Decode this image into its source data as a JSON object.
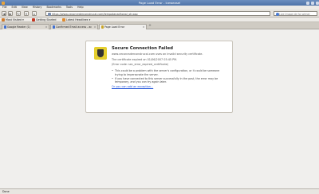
{
  "window": {
    "title": "Page Load Error - Iceweasel"
  },
  "menu": [
    "File",
    "Edit",
    "View",
    "History",
    "Bookmarks",
    "Tools",
    "Help"
  ],
  "nav": {
    "url": "https://www.ceconrederconstrucal.com/tempotanadhonal_otr.asp",
    "search_placeholder": "Live Image de for wimer"
  },
  "bookmarks": [
    {
      "label": "Most Visited ▾",
      "color": "#d07a2a"
    },
    {
      "label": "Getting Started",
      "color": "#c4341e"
    },
    {
      "label": "Latest Headlines ▾",
      "color": "#e08a2e"
    }
  ],
  "tabs": [
    {
      "label": "Google Reader (1)",
      "color": "#3f6fd1"
    },
    {
      "label": "Confirmed Email access - ac",
      "color": "#3f6fd1"
    },
    {
      "label": "Page Load Error",
      "color": "#c9a52a"
    }
  ],
  "error": {
    "title": "Secure Connection Failed",
    "line1": "www.ceconraderconstrucal.com uses an invalid security certificate.",
    "line2": "The certificate expired on 01/06/2007 03:45 PM.",
    "code": "(Error code: sec_error_expired_certificate)",
    "bullets": [
      "This could be a problem with the server's configuration, or it could be someone trying to impersonate the server.",
      "If you have connected to this server successfully in the past, the error may be temporary, and you can try again later."
    ],
    "exception_link": "Or you can add an exception..."
  },
  "status": {
    "text": "Done"
  }
}
